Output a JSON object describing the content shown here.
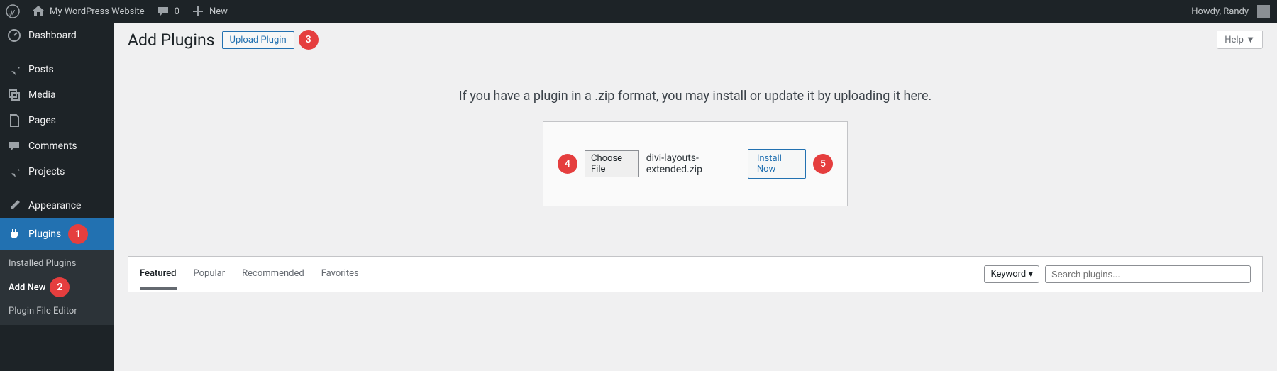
{
  "adminbar": {
    "site_name": "My WordPress Website",
    "comments": "0",
    "new_label": "New",
    "howdy": "Howdy, Randy"
  },
  "sidebar": {
    "items": [
      {
        "label": "Dashboard"
      },
      {
        "label": "Posts"
      },
      {
        "label": "Media"
      },
      {
        "label": "Pages"
      },
      {
        "label": "Comments"
      },
      {
        "label": "Projects"
      },
      {
        "label": "Appearance"
      },
      {
        "label": "Plugins"
      }
    ],
    "submenu": [
      {
        "label": "Installed Plugins"
      },
      {
        "label": "Add New"
      },
      {
        "label": "Plugin File Editor"
      }
    ]
  },
  "page": {
    "title": "Add Plugins",
    "upload_btn": "Upload Plugin",
    "help": "Help ▼",
    "upload_msg": "If you have a plugin in a .zip format, you may install or update it by uploading it here.",
    "choose_file": "Choose File",
    "file_name": "divi-layouts-extended.zip",
    "install_now": "Install Now"
  },
  "filter": {
    "tabs": [
      "Featured",
      "Popular",
      "Recommended",
      "Favorites"
    ],
    "keyword": "Keyword",
    "search_placeholder": "Search plugins..."
  },
  "badges": {
    "b1": "1",
    "b2": "2",
    "b3": "3",
    "b4": "4",
    "b5": "5"
  }
}
